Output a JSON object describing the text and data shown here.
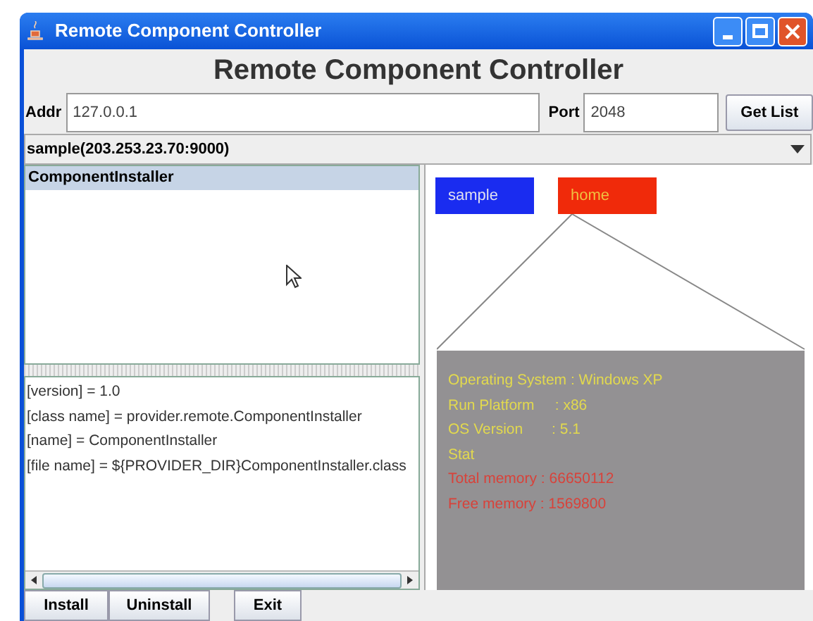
{
  "window": {
    "title": "Remote Component Controller"
  },
  "heading": "Remote Component Controller",
  "addr": {
    "label": "Addr",
    "value": "127.0.0.1"
  },
  "port": {
    "label": "Port",
    "value": "2048"
  },
  "get_list_button": "Get List",
  "server_combo": {
    "value": "sample(203.253.23.70:9000)"
  },
  "component_list": [
    {
      "label": "ComponentInstaller",
      "selected": true
    }
  ],
  "properties": [
    "[version] = 1.0",
    "[class name] = provider.remote.ComponentInstaller",
    "[name] = ComponentInstaller",
    "[file name] = ${PROVIDER_DIR}ComponentInstaller.class"
  ],
  "nodes": [
    {
      "label": "sample",
      "color": "#1a2cf0"
    },
    {
      "label": "home",
      "color": "#f02a0a"
    }
  ],
  "info": [
    {
      "text": "Operating System : Windows XP",
      "color": "#e2d94e"
    },
    {
      "text": "Run Platform     : x86",
      "color": "#e2d94e"
    },
    {
      "text": "OS Version       : 5.1",
      "color": "#e2d94e"
    },
    {
      "text": "Stat",
      "color": "#e2d94e"
    },
    {
      "text": "Total memory : 66650112",
      "color": "#d8423a"
    },
    {
      "text": "Free memory : 1569800",
      "color": "#d8423a"
    }
  ],
  "buttons": [
    "Install",
    "Uninstall",
    "Exit"
  ]
}
